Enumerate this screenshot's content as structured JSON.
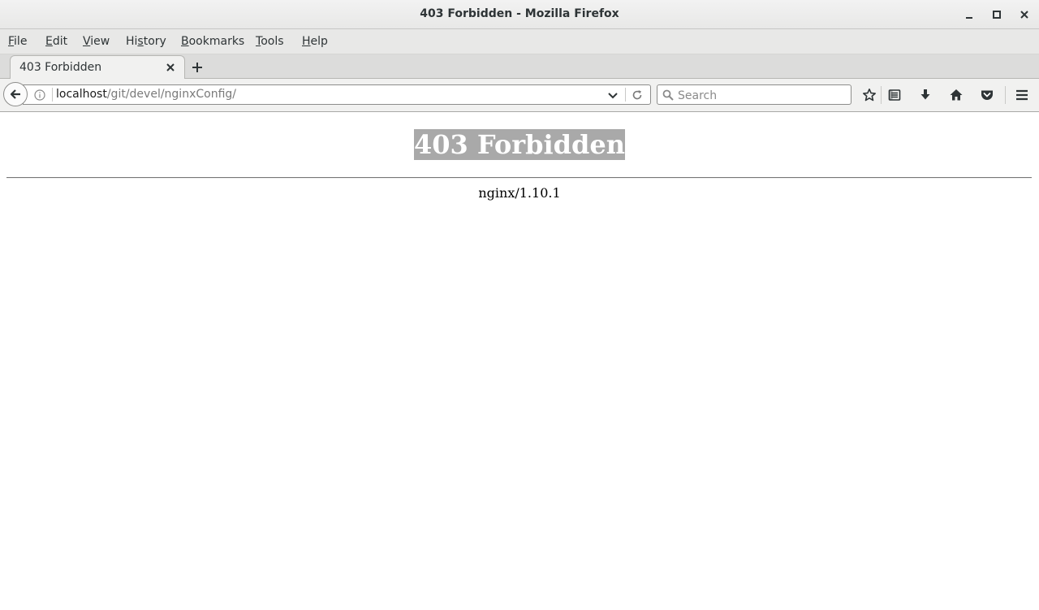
{
  "window": {
    "title": "403 Forbidden - Mozilla Firefox"
  },
  "menubar": {
    "items": [
      {
        "label": "File",
        "accesskey": "F"
      },
      {
        "label": "Edit",
        "accesskey": "E"
      },
      {
        "label": "View",
        "accesskey": "V"
      },
      {
        "label": "History",
        "accesskey": "s"
      },
      {
        "label": "Bookmarks",
        "accesskey": "B"
      },
      {
        "label": "Tools",
        "accesskey": "T"
      },
      {
        "label": "Help",
        "accesskey": "H"
      }
    ]
  },
  "tabs": [
    {
      "label": "403 Forbidden",
      "active": true
    }
  ],
  "navbar": {
    "url_host": "localhost",
    "url_path": "/git/devel/nginxConfig/",
    "search_placeholder": "Search",
    "toolbar_icons": [
      "bookmark-star-icon",
      "reading-list-icon",
      "downloads-icon",
      "home-icon",
      "pocket-icon",
      "menu-icon"
    ]
  },
  "page": {
    "heading": "403 Forbidden",
    "server": "nginx/1.10.1",
    "heading_highlight_color": "#a9a9a9"
  }
}
